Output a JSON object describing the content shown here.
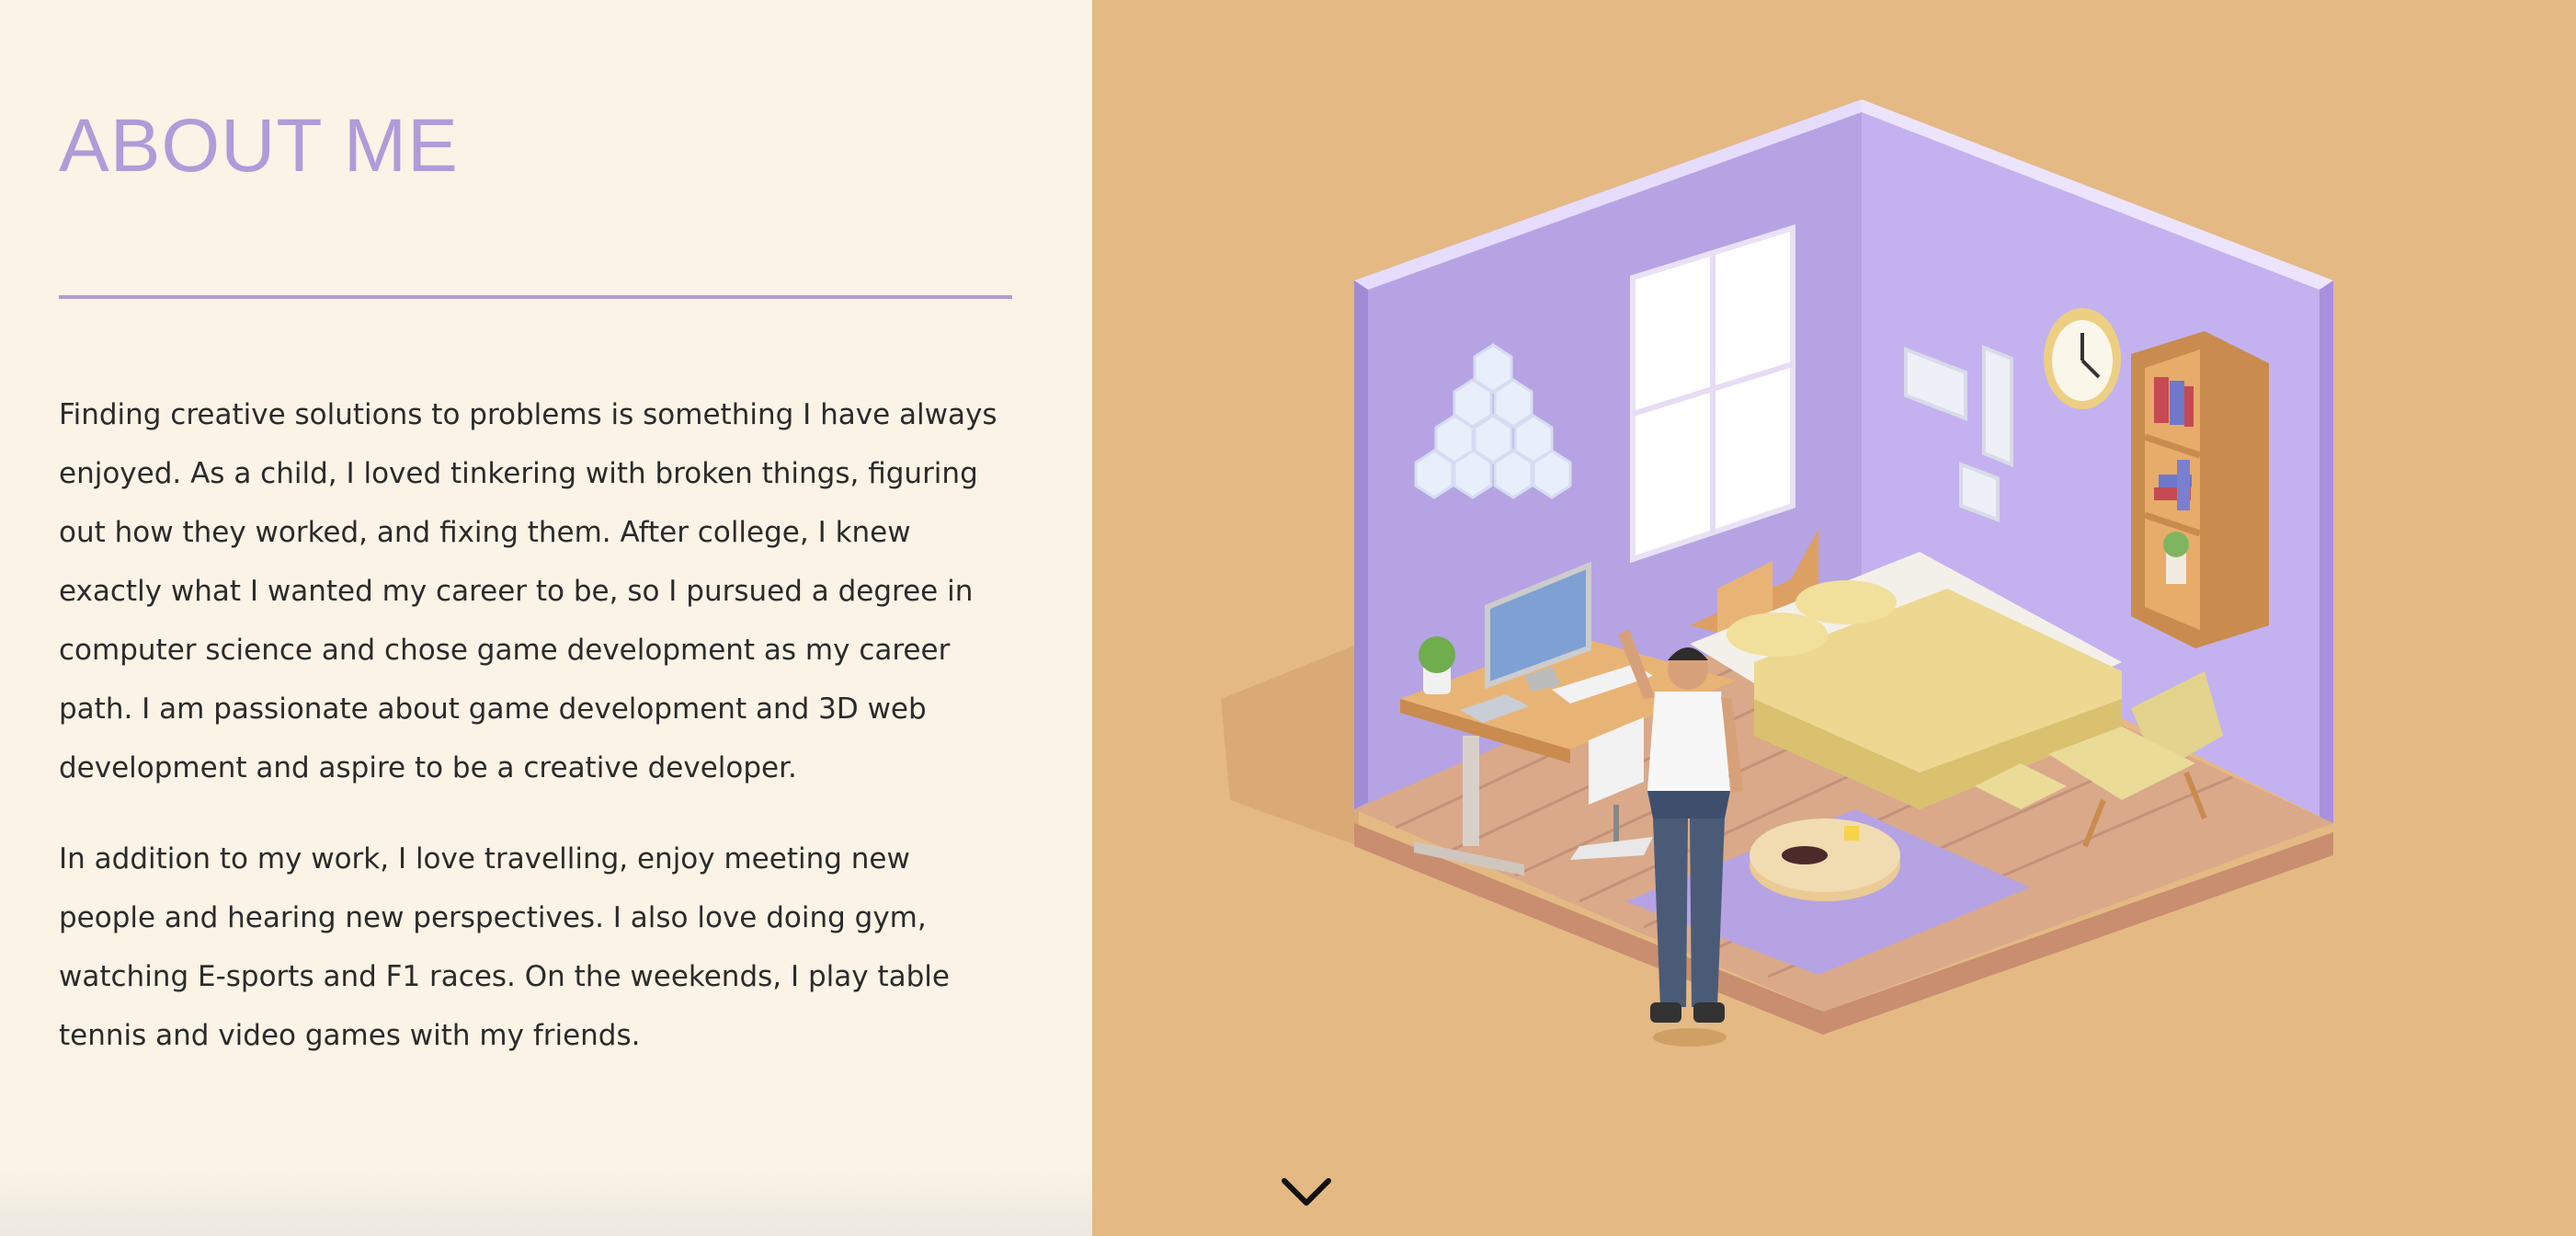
{
  "colors": {
    "left_bg": "#faf3e6",
    "right_bg": "#e4b984",
    "accent": "#b19bd8",
    "text": "#2b2b2b",
    "wall_left": "#b6a3e3",
    "wall_right": "#c3b2ef",
    "floor": "#d9a98a",
    "bed": "#ecd890"
  },
  "about": {
    "title": "ABOUT ME",
    "paragraph_1": "Finding creative solutions to problems is something I have always enjoyed. As a child, I loved tinkering with broken things, figuring out how they worked, and fixing them. After college, I knew exactly what I wanted my career to be, so I pursued a degree in computer science and chose game development as my career path. I am passionate about game development and 3D web development and aspire to be a creative developer.",
    "paragraph_2": "In addition to my work, I love travelling, enjoy meeting new people and hearing new perspectives. I also love doing gym, watching E-sports and F1 races. On the weekends, I play table tennis and video games with my friends."
  },
  "scroll_icon": "chevron-down-icon"
}
